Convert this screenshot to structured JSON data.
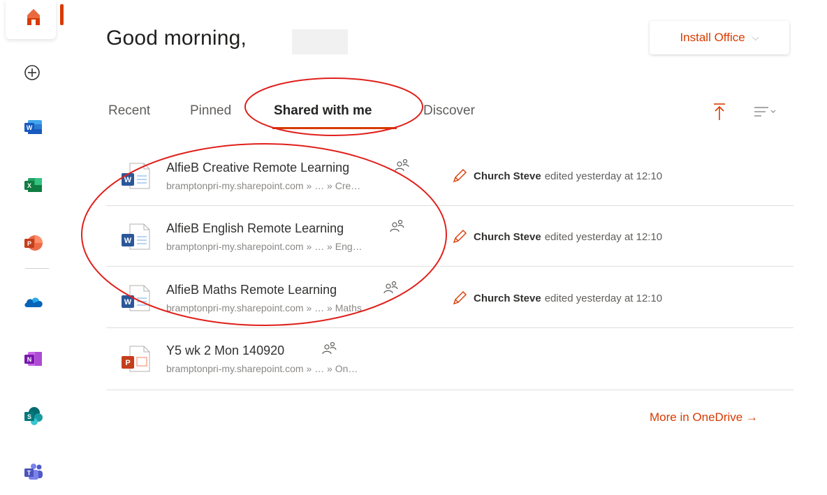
{
  "header": {
    "greeting": "Good morning,",
    "install_label": "Install Office",
    "install_chevron": "⌵"
  },
  "tabs": [
    {
      "label": "Recent",
      "active": false
    },
    {
      "label": "Pinned",
      "active": false
    },
    {
      "label": "Shared with me",
      "active": true
    },
    {
      "label": "Discover",
      "active": false
    }
  ],
  "toolbar": {
    "upload_icon": "upload-icon",
    "sort_icon": "sort-icon"
  },
  "files": [
    {
      "name": "AlfieB Creative Remote Learning",
      "path": "bramptonpri-my.sharepoint.com » … » Cre…",
      "type": "word",
      "editor": "Church Steve",
      "activity": "edited yesterday at 12:10"
    },
    {
      "name": "AlfieB English Remote Learning",
      "path": "bramptonpri-my.sharepoint.com » … » Eng…",
      "type": "word",
      "editor": "Church Steve",
      "activity": "edited yesterday at 12:10"
    },
    {
      "name": "AlfieB Maths Remote Learning",
      "path": "bramptonpri-my.sharepoint.com » … » Maths",
      "type": "word",
      "editor": "Church Steve",
      "activity": "edited yesterday at 12:10"
    },
    {
      "name": "Y5 wk 2 Mon 140920",
      "path": "bramptonpri-my.sharepoint.com » … » On…",
      "type": "powerpoint",
      "editor": "",
      "activity": ""
    }
  ],
  "footer": {
    "more_link": "More in OneDrive →"
  },
  "rail": {
    "apps": [
      "home-icon",
      "create-icon",
      "word-icon",
      "excel-icon",
      "powerpoint-icon",
      "onedrive-icon",
      "onenote-icon",
      "sharepoint-icon",
      "teams-icon"
    ]
  },
  "colors": {
    "accent": "#d83b01",
    "annotation": "#e0201b",
    "word": "#2b579a",
    "excel": "#217346",
    "powerpoint": "#d24726",
    "onenote": "#7719aa",
    "onedrive": "#0364b8",
    "sharepoint": "#038387",
    "teams": "#5059c9"
  }
}
